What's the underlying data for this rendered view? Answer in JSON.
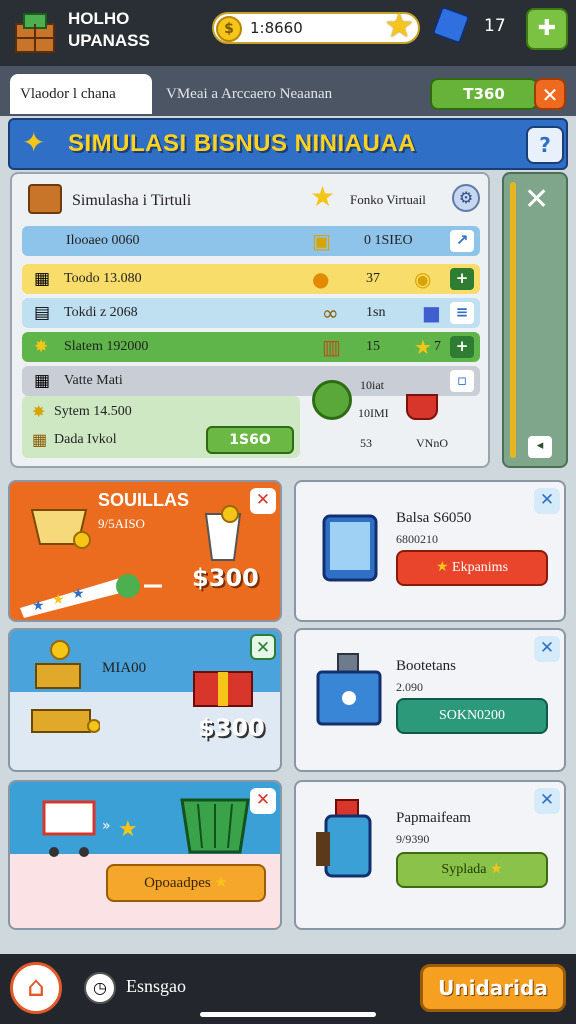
{
  "header": {
    "app_title_line1": "HOLHO",
    "app_title_line2": "UPANASS",
    "coin_value": "1:8660",
    "count": "17"
  },
  "tabs": {
    "active": "Vlaodor l chana",
    "inactive": "VMeai a Arccaero Neaanan",
    "action_label": "T360"
  },
  "banner": {
    "title": "SIMULASI BISNUS NINIAUAA"
  },
  "panel": {
    "title": "Simulasha i Tirtuli",
    "right_label": "Fonko Virtuail",
    "rows": [
      {
        "label": "Ilooaeo 0060",
        "value": "0 1SIEO",
        "bg": "#8ec3ea"
      },
      {
        "label": "Toodo 13.080",
        "value": "37",
        "bg": "#f8dd6a"
      },
      {
        "label": "Tokdi z 2068",
        "value": "1sn",
        "bg": "#bfe0f0"
      },
      {
        "label": "Slatem 192000",
        "value": "15",
        "extra": "7",
        "bg": "#5fb54a"
      },
      {
        "label": "Vatte Mati",
        "value": "",
        "bg": "#c9ced6"
      }
    ],
    "lower_rows": [
      {
        "label": "Sytem 14.500"
      },
      {
        "label": "Dada Ivkol"
      }
    ],
    "lower_button": "1S6O",
    "side_text1": "10iat",
    "side_text2": "10IMI",
    "side_text3": "53",
    "side_text4": "VNnO"
  },
  "cards": {
    "c1": {
      "title": "SOUILLAS",
      "sub": "9/5AISO",
      "price": "$300"
    },
    "c2": {
      "label": "MIA00",
      "price": "$300"
    },
    "c3": {
      "button": "Opoaadpes"
    },
    "c4": {
      "title": "Balsa S6050",
      "sub": "6800210",
      "button": "Ekpanims"
    },
    "c5": {
      "title": "Bootetans",
      "sub": "2.090",
      "button": "SOKN0200"
    },
    "c6": {
      "title": "Papmaifeam",
      "sub": "9/9390",
      "button": "Syplada"
    }
  },
  "bottom": {
    "label": "Esnsgao",
    "update_button": "Unidarida"
  },
  "colors": {
    "accent": "#2f6fc6",
    "orange": "#ec6c1f",
    "green": "#67b33a",
    "gold": "#f5c518"
  }
}
